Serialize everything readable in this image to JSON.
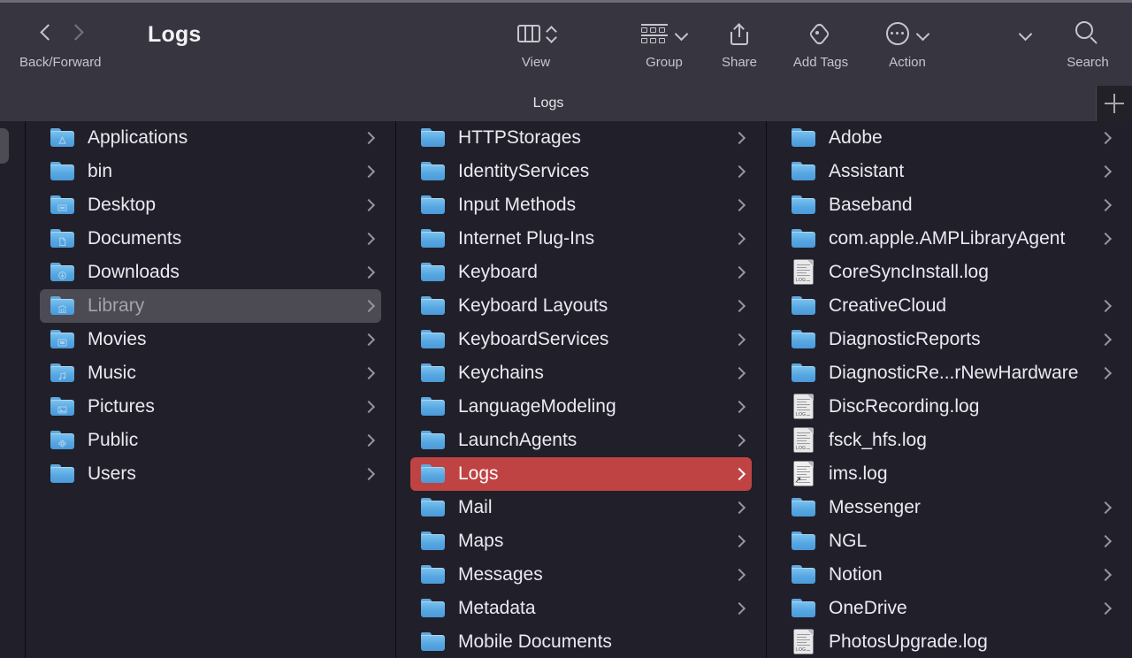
{
  "window": {
    "title": "Logs"
  },
  "toolbar": {
    "back_forward_label": "Back/Forward",
    "view_label": "View",
    "group_label": "Group",
    "share_label": "Share",
    "add_tags_label": "Add Tags",
    "action_label": "Action",
    "search_label": "Search",
    "icons": {
      "back": "chevron-left-icon",
      "forward": "chevron-right-icon",
      "view": "column-view-icon",
      "view_stepper": "up-down-chevron-icon",
      "group": "group-icon",
      "group_caret": "chevron-down-icon",
      "share": "share-icon",
      "add_tags": "tag-icon",
      "action": "ellipsis-circle-icon",
      "action_caret": "chevron-down-icon",
      "more_caret": "chevron-down-icon",
      "search": "search-icon"
    }
  },
  "tabbar": {
    "tab_label": "Logs",
    "new_tab_label": "+"
  },
  "colors": {
    "toolbar_bg": "#37353f",
    "content_bg": "#211f29",
    "selection_gray": "#4c4a52",
    "selection_red": "#c04343",
    "folder_blue": "#57a7e2",
    "text": "#eceaf0"
  },
  "columns": [
    {
      "name": "column-1",
      "items": [
        {
          "label": "Applications",
          "kind": "folder",
          "glyph": "app-folder",
          "chevron": true,
          "state": "normal"
        },
        {
          "label": "bin",
          "kind": "folder",
          "glyph": "plain",
          "chevron": true,
          "state": "normal"
        },
        {
          "label": "Desktop",
          "kind": "folder",
          "glyph": "desktop",
          "chevron": true,
          "state": "normal"
        },
        {
          "label": "Documents",
          "kind": "folder",
          "glyph": "document",
          "chevron": true,
          "state": "normal"
        },
        {
          "label": "Downloads",
          "kind": "folder",
          "glyph": "download",
          "chevron": true,
          "state": "normal"
        },
        {
          "label": "Library",
          "kind": "folder",
          "glyph": "library",
          "chevron": true,
          "state": "selected-gray"
        },
        {
          "label": "Movies",
          "kind": "folder",
          "glyph": "movie",
          "chevron": true,
          "state": "normal"
        },
        {
          "label": "Music",
          "kind": "folder",
          "glyph": "music",
          "chevron": true,
          "state": "normal"
        },
        {
          "label": "Pictures",
          "kind": "folder",
          "glyph": "picture",
          "chevron": true,
          "state": "normal"
        },
        {
          "label": "Public",
          "kind": "folder",
          "glyph": "public",
          "chevron": true,
          "state": "normal"
        },
        {
          "label": "Users",
          "kind": "folder",
          "glyph": "plain",
          "chevron": true,
          "state": "normal"
        }
      ]
    },
    {
      "name": "column-2",
      "items": [
        {
          "label": "HTTPStorages",
          "kind": "folder",
          "glyph": "plain",
          "chevron": true,
          "state": "normal"
        },
        {
          "label": "IdentityServices",
          "kind": "folder",
          "glyph": "plain",
          "chevron": true,
          "state": "normal"
        },
        {
          "label": "Input Methods",
          "kind": "folder",
          "glyph": "plain",
          "chevron": true,
          "state": "normal"
        },
        {
          "label": "Internet Plug-Ins",
          "kind": "folder",
          "glyph": "plain",
          "chevron": true,
          "state": "normal"
        },
        {
          "label": "Keyboard",
          "kind": "folder",
          "glyph": "plain",
          "chevron": true,
          "state": "normal"
        },
        {
          "label": "Keyboard Layouts",
          "kind": "folder",
          "glyph": "plain",
          "chevron": true,
          "state": "normal"
        },
        {
          "label": "KeyboardServices",
          "kind": "folder",
          "glyph": "plain",
          "chevron": true,
          "state": "normal"
        },
        {
          "label": "Keychains",
          "kind": "folder",
          "glyph": "plain",
          "chevron": true,
          "state": "normal"
        },
        {
          "label": "LanguageModeling",
          "kind": "folder",
          "glyph": "plain",
          "chevron": true,
          "state": "normal"
        },
        {
          "label": "LaunchAgents",
          "kind": "folder",
          "glyph": "plain",
          "chevron": true,
          "state": "normal"
        },
        {
          "label": "Logs",
          "kind": "folder",
          "glyph": "plain",
          "chevron": true,
          "state": "selected-red"
        },
        {
          "label": "Mail",
          "kind": "folder",
          "glyph": "plain",
          "chevron": true,
          "state": "normal"
        },
        {
          "label": "Maps",
          "kind": "folder",
          "glyph": "plain",
          "chevron": true,
          "state": "normal"
        },
        {
          "label": "Messages",
          "kind": "folder",
          "glyph": "plain",
          "chevron": true,
          "state": "normal"
        },
        {
          "label": "Metadata",
          "kind": "folder",
          "glyph": "plain",
          "chevron": true,
          "state": "normal"
        },
        {
          "label": "Mobile Documents",
          "kind": "folder",
          "glyph": "plain",
          "chevron": false,
          "state": "normal"
        }
      ]
    },
    {
      "name": "column-3",
      "items": [
        {
          "label": "Adobe",
          "kind": "folder",
          "glyph": "plain",
          "chevron": true,
          "state": "normal"
        },
        {
          "label": "Assistant",
          "kind": "folder",
          "glyph": "plain",
          "chevron": true,
          "state": "normal"
        },
        {
          "label": "Baseband",
          "kind": "folder",
          "glyph": "plain",
          "chevron": true,
          "state": "normal"
        },
        {
          "label": "com.apple.AMPLibraryAgent",
          "kind": "folder",
          "glyph": "plain",
          "chevron": true,
          "state": "normal"
        },
        {
          "label": "CoreSyncInstall.log",
          "kind": "logfile",
          "chevron": false,
          "state": "normal"
        },
        {
          "label": "CreativeCloud",
          "kind": "folder",
          "glyph": "plain",
          "chevron": true,
          "state": "normal"
        },
        {
          "label": "DiagnosticReports",
          "kind": "folder",
          "glyph": "plain",
          "chevron": true,
          "state": "normal"
        },
        {
          "label": "DiagnosticRe...rNewHardware",
          "kind": "folder",
          "glyph": "plain",
          "chevron": true,
          "state": "normal"
        },
        {
          "label": "DiscRecording.log",
          "kind": "logfile",
          "chevron": false,
          "state": "normal"
        },
        {
          "label": "fsck_hfs.log",
          "kind": "logfile",
          "chevron": false,
          "state": "normal"
        },
        {
          "label": "ims.log",
          "kind": "aliasfile",
          "chevron": false,
          "state": "normal"
        },
        {
          "label": "Messenger",
          "kind": "folder",
          "glyph": "plain",
          "chevron": true,
          "state": "normal"
        },
        {
          "label": "NGL",
          "kind": "folder",
          "glyph": "plain",
          "chevron": true,
          "state": "normal"
        },
        {
          "label": "Notion",
          "kind": "folder",
          "glyph": "plain",
          "chevron": true,
          "state": "normal"
        },
        {
          "label": "OneDrive",
          "kind": "folder",
          "glyph": "plain",
          "chevron": true,
          "state": "normal"
        },
        {
          "label": "PhotosUpgrade.log",
          "kind": "logfile",
          "chevron": false,
          "state": "normal"
        }
      ]
    }
  ]
}
